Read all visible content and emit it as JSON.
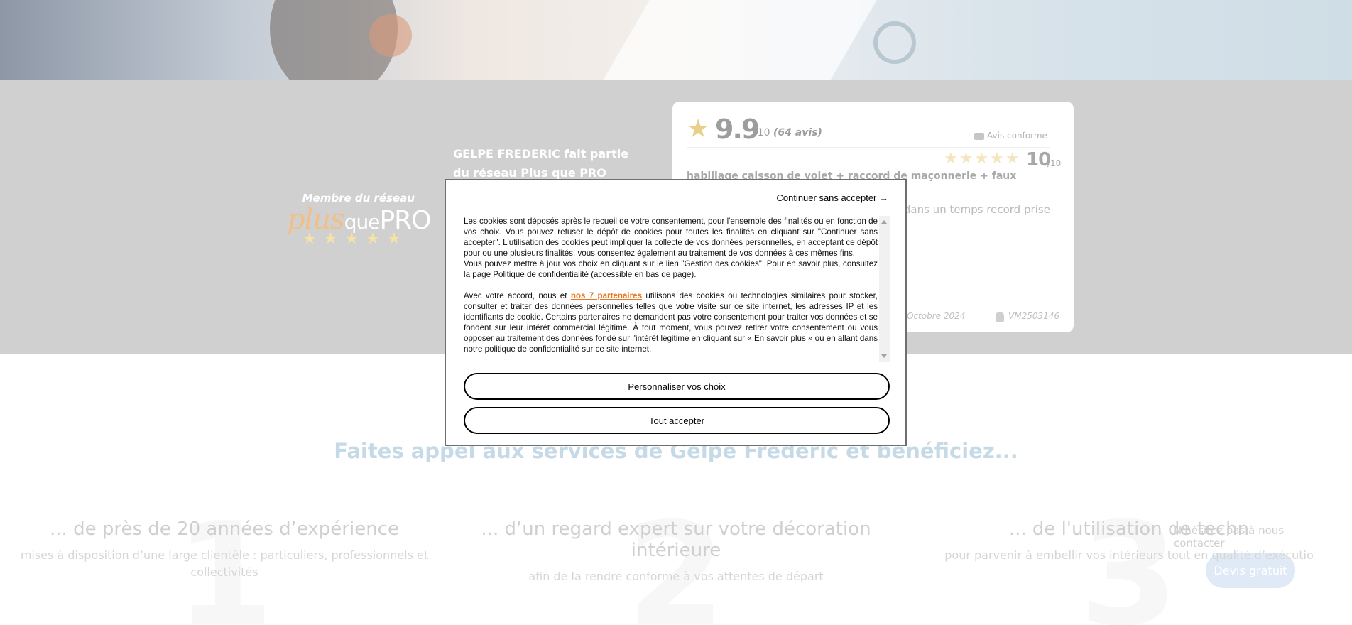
{
  "network": {
    "badge_label": "Membre du réseau",
    "brand_plus": "plus",
    "brand_que": "que",
    "brand_pro": "PRO",
    "stars": "★★★★★",
    "title": "GELPE FREDERIC fait partie du réseau Plus que PRO"
  },
  "review": {
    "score": "9.9",
    "score_den": "/10",
    "count": "(64 avis)",
    "conform": "Avis conforme",
    "stars": "★★★★★",
    "note": "10",
    "note_den": "/10",
    "title": "habillage caisson de volet + raccord de maçonnerie + faux plafond a ancy",
    "text": "onnelle au service des clients, réalisé et dans un temps record prise intelligents et a différence.",
    "date": "Octobre 2024",
    "user": "VM2503146"
  },
  "services": {
    "title": "Faites appel aux services de Gelpe Frédéric et bénéficiez...",
    "features": [
      {
        "num": "1",
        "title": "... de près de 20 années d’expérience",
        "desc": "mises à disposition d’une large clientèle : particuliers, professionnels et collectivités"
      },
      {
        "num": "2",
        "title": "... d’un regard expert sur votre décoration intérieure",
        "desc": "afin de la rendre conforme à vos attentes de départ"
      },
      {
        "num": "3",
        "title": "... de l'utilisation de techn",
        "desc": "pour parvenir à embellir vos intérieurs tout en qualité d’exécutio"
      }
    ]
  },
  "contact": {
    "text": "N'hésitez pas à nous contacter",
    "button": "Devis gratuit"
  },
  "cookie": {
    "continue_label": "Continuer sans accepter →",
    "para1": "Les cookies sont déposés après le recueil de votre consentement, pour l'ensemble des finalités ou en fonction de vos choix. Vous pouvez refuser le dépôt de cookies pour toutes les finalités en cliquant sur \"Continuer sans accepter\". L'utilisation des cookies peut impliquer la collecte de vos données personnelles, en acceptant ce dépôt pour ou une plusieurs finalités, vous consentez également au traitement de vos données à ces mêmes fins.",
    "para2": "Vous pouvez mettre à jour vos choix en cliquant sur le lien \"Gestion des cookies\". Pour en savoir plus, consultez la page Politique de confidentialité (accessible en bas de page).",
    "para3_before": "Avec votre accord, nous et ",
    "partners_link": "nos 7 partenaires",
    "para3_after": " utilisons des cookies ou technologies similaires pour stocker, consulter et traiter des données personnelles telles que votre visite sur ce site internet, les adresses IP et les identifiants de cookie. Certains partenaires ne demandent pas votre consentement pour traiter vos données et se fondent sur leur intérêt commercial légitime. À tout moment, vous pouvez retirer votre consentement ou vous opposer au traitement des données fondé sur l'intérêt légitime en cliquant sur « En savoir plus » ou en allant dans notre politique de confidentialité sur ce site internet.",
    "customize_button": "Personnaliser vos choix",
    "accept_button": "Tout accepter"
  }
}
